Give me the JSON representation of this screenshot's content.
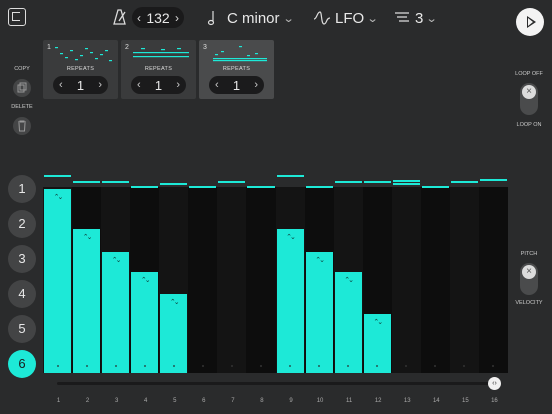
{
  "header": {
    "tempo": "132",
    "tempo_dec": "‹",
    "tempo_inc": "›",
    "scale": "C minor",
    "mod": "LFO",
    "count": "3",
    "chevron": "⌄"
  },
  "patterns": [
    {
      "num": "1",
      "repeats_label": "REPEATS",
      "repeats": "1",
      "selected": false
    },
    {
      "num": "2",
      "repeats_label": "REPEATS",
      "repeats": "1",
      "selected": false
    },
    {
      "num": "3",
      "repeats_label": "REPEATS",
      "repeats": "1",
      "selected": true
    }
  ],
  "left": {
    "copy": "COPY",
    "delete": "DELETE"
  },
  "right": {
    "loop_off": "LOOP OFF",
    "loop_on": "LOOP ON",
    "pitch": "PITCH",
    "velocity": "VELOCITY"
  },
  "channels": [
    "1",
    "2",
    "3",
    "4",
    "5",
    "6"
  ],
  "active_channel": 6,
  "steps": {
    "labels": [
      "1",
      "2",
      "3",
      "4",
      "5",
      "6",
      "7",
      "8",
      "9",
      "10",
      "11",
      "12",
      "13",
      "14",
      "15",
      "16"
    ],
    "velocity": [
      1.0,
      0.78,
      0.66,
      0.55,
      0.43,
      0,
      0,
      0,
      0.78,
      0.66,
      0.55,
      0.32,
      0,
      0,
      0,
      0
    ],
    "accent_color": "#1de9d7"
  }
}
